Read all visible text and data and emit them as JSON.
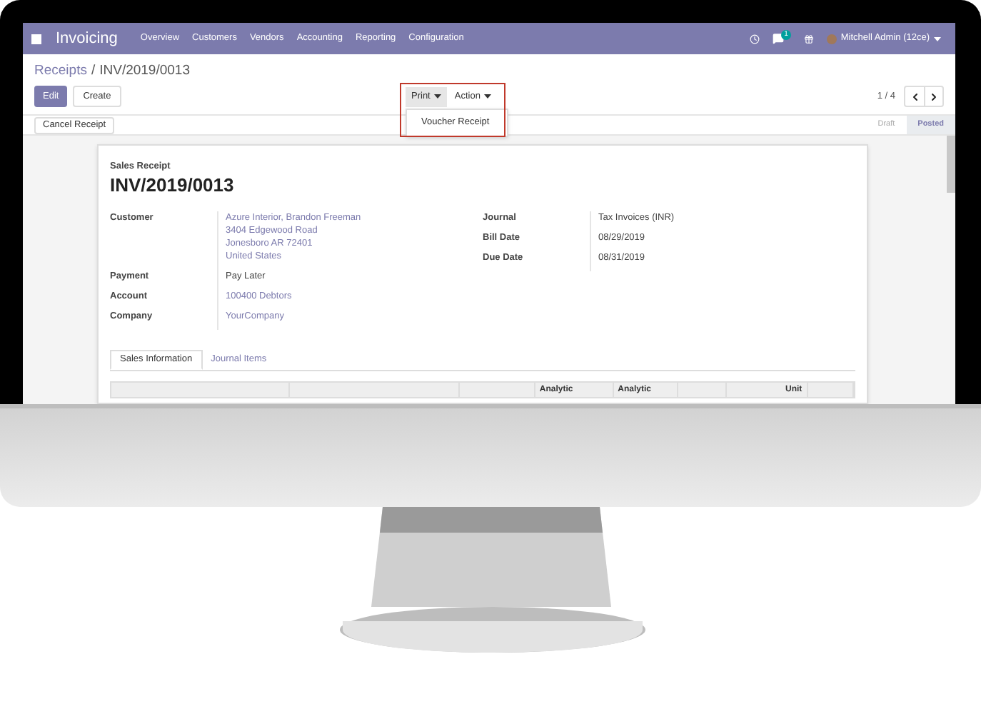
{
  "app": {
    "name": "Invoicing",
    "menu": [
      "Overview",
      "Customers",
      "Vendors",
      "Accounting",
      "Reporting",
      "Configuration"
    ],
    "message_count": "1",
    "user": "Mitchell Admin (12ce)"
  },
  "breadcrumb": {
    "parent": "Receipts",
    "separator": "/",
    "current": "INV/2019/0013"
  },
  "buttons": [
    {
      "label": "Edit",
      "kind": "primary"
    },
    {
      "label": "Create",
      "kind": "secondary"
    }
  ],
  "actions": [
    {
      "label": "Print",
      "selected": true
    },
    {
      "label": "Action",
      "selected": false
    }
  ],
  "dropdown": {
    "items": [
      "Voucher Receipt"
    ]
  },
  "pager": "1 / 4",
  "header_buttons": [
    "Cancel Receipt"
  ],
  "statuses": [
    {
      "label": "Draft",
      "selected": false
    },
    {
      "label": "Posted",
      "selected": true
    }
  ],
  "sheet": {
    "type_label": "Sales Receipt",
    "title": "INV/2019/0013",
    "left_fields": [
      {
        "label": "Customer",
        "kind": "link",
        "lines": [
          "Azure Interior, Brandon Freeman",
          "3404 Edgewood Road",
          "Jonesboro AR 72401",
          "United States"
        ]
      },
      {
        "label": "Payment",
        "kind": "plain",
        "lines": [
          "Pay Later"
        ]
      },
      {
        "label": "Account",
        "kind": "link",
        "lines": [
          "100400 Debtors"
        ]
      },
      {
        "label": "Company",
        "kind": "link",
        "lines": [
          "YourCompany"
        ]
      }
    ],
    "right_fields": [
      {
        "label": "Journal",
        "lines": [
          "Tax Invoices (INR)"
        ]
      },
      {
        "label": "Bill Date",
        "lines": [
          "08/29/2019"
        ]
      },
      {
        "label": "Due Date",
        "lines": [
          "08/31/2019"
        ]
      }
    ]
  },
  "tabs": [
    {
      "label": "Sales Information",
      "selected": true
    },
    {
      "label": "Journal Items",
      "selected": false
    }
  ],
  "table": {
    "columns": [
      {
        "kind": "blank"
      },
      {
        "kind": "blank"
      },
      {
        "kind": "blank"
      },
      {
        "kind": "text",
        "heading": "Analytic"
      },
      {
        "kind": "text",
        "heading": "Analytic"
      },
      {
        "kind": "blank"
      },
      {
        "kind": "text",
        "heading": "Unit"
      },
      {
        "kind": "blank"
      }
    ]
  }
}
